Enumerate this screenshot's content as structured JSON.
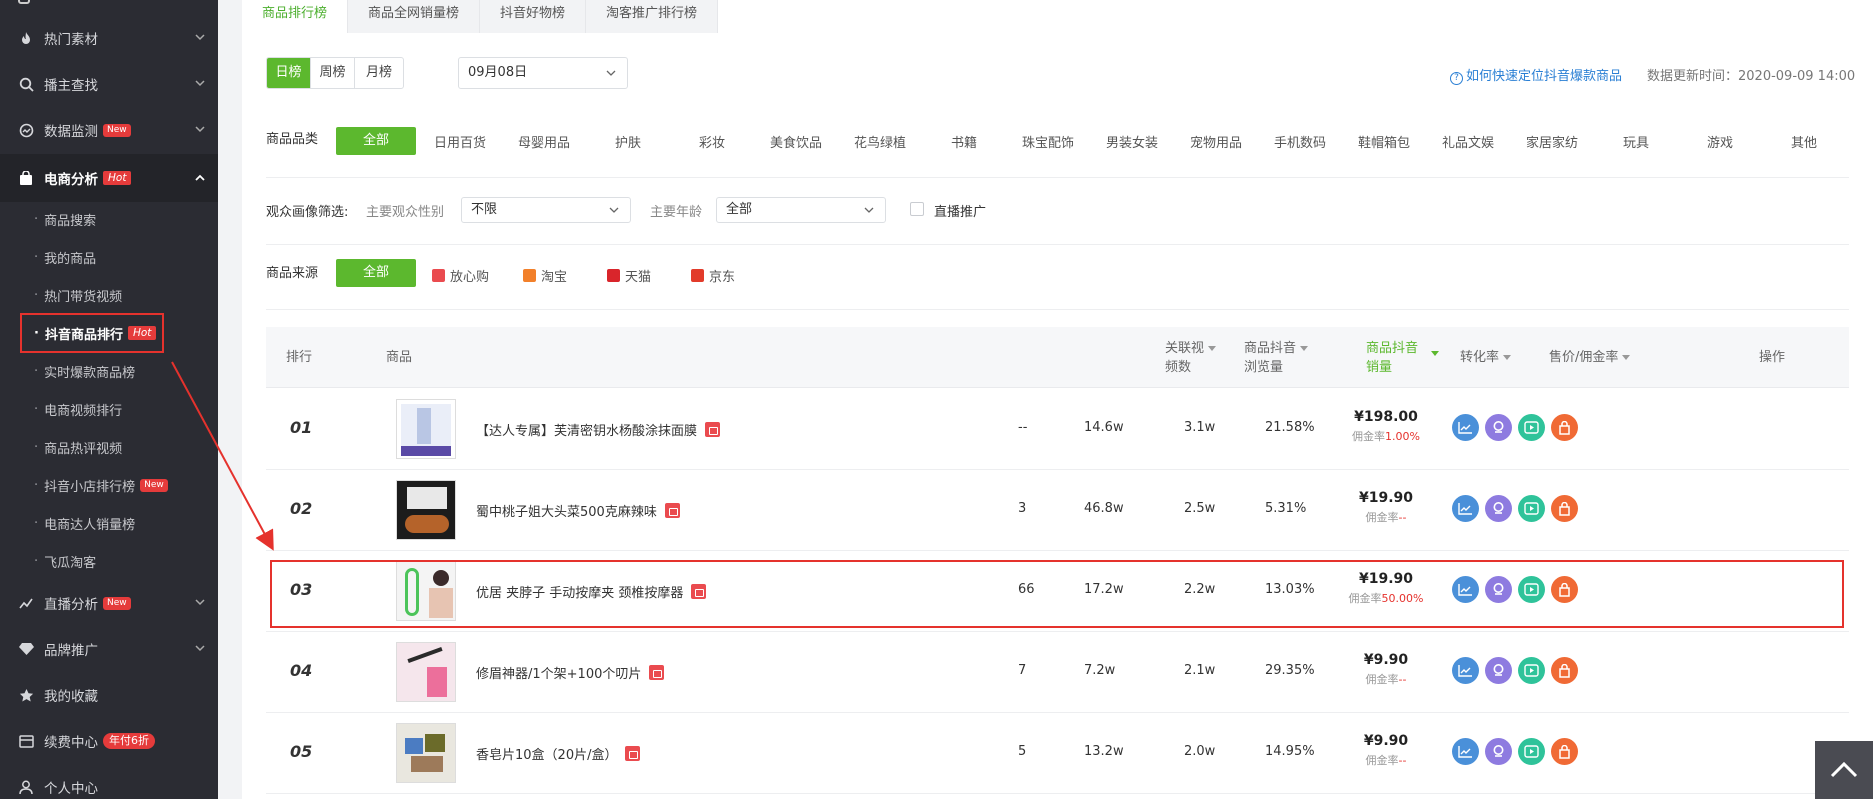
{
  "sidebar": {
    "items": [
      {
        "label": "热门素材",
        "icon": "fire-icon"
      },
      {
        "label": "播主查找",
        "icon": "search-icon"
      },
      {
        "label": "数据监测",
        "icon": "monitor-icon",
        "badge": "New"
      },
      {
        "label": "电商分析",
        "icon": "bag-icon",
        "badge": "Hot"
      },
      {
        "label": "直播分析",
        "icon": "live-icon",
        "badge": "New"
      },
      {
        "label": "品牌推广",
        "icon": "diamond-icon"
      },
      {
        "label": "我的收藏",
        "icon": "star-icon"
      },
      {
        "label": "续费中心",
        "icon": "card-icon",
        "badge": "年付6折"
      },
      {
        "label": "个人中心",
        "icon": "user-icon"
      }
    ],
    "sub_items": [
      {
        "label": "商品搜索"
      },
      {
        "label": "我的商品"
      },
      {
        "label": "热门带货视频"
      },
      {
        "label": "抖音商品排行",
        "badge": "Hot"
      },
      {
        "label": "实时爆款商品榜"
      },
      {
        "label": "电商视频排行"
      },
      {
        "label": "商品热评视频"
      },
      {
        "label": "抖音小店排行榜",
        "badge": "New"
      },
      {
        "label": "电商达人销量榜"
      },
      {
        "label": "飞瓜淘客"
      }
    ]
  },
  "tabs": [
    "商品排行榜",
    "商品全网销量榜",
    "抖音好物榜",
    "淘客推广排行榜"
  ],
  "period": {
    "options": [
      "日榜",
      "周榜",
      "月榜"
    ],
    "date": "09月08日"
  },
  "help_link": "如何快速定位抖音爆款商品",
  "update_time": "数据更新时间：2020-09-09 14:00",
  "category": {
    "label": "商品品类",
    "items": [
      "全部",
      "日用百货",
      "母婴用品",
      "护肤",
      "彩妆",
      "美食饮品",
      "花鸟绿植",
      "书籍",
      "珠宝配饰",
      "男装女装",
      "宠物用品",
      "手机数码",
      "鞋帽箱包",
      "礼品文娱",
      "家居家纺",
      "玩具",
      "游戏",
      "其他"
    ]
  },
  "audience": {
    "label": "观众画像筛选:",
    "gender_label": "主要观众性别",
    "gender_value": "不限",
    "age_label": "主要年龄",
    "age_value": "全部",
    "live_promo": "直播推广"
  },
  "source": {
    "label": "商品来源",
    "items": [
      {
        "name": "全部"
      },
      {
        "name": "放心购",
        "color": "#ea4b4f"
      },
      {
        "name": "淘宝",
        "color": "#f2802a"
      },
      {
        "name": "天猫",
        "color": "#d9252b"
      },
      {
        "name": "京东",
        "color": "#e23b2a"
      }
    ]
  },
  "table": {
    "headers": [
      "排行",
      "商品",
      "关联视频数",
      "商品抖音浏览量",
      "商品抖音销量",
      "转化率",
      "售价/佣金率",
      "操作"
    ],
    "header_lines": {
      "videos": [
        "关联视",
        "频数"
      ],
      "views": [
        "商品抖音",
        "浏览量"
      ],
      "sales": [
        "商品抖音",
        "销量"
      ]
    },
    "commission_label": "佣金率",
    "rows": [
      {
        "rank": "01",
        "name": "【达人专属】芙清密钥水杨酸涂抹面膜",
        "videos": "--",
        "views": "14.6w",
        "sales": "3.1w",
        "conversion": "21.58%",
        "price": "¥198.00",
        "commission": "1.00%"
      },
      {
        "rank": "02",
        "name": "蜀中桃子姐大头菜500克麻辣味",
        "videos": "3",
        "views": "46.8w",
        "sales": "2.5w",
        "conversion": "5.31%",
        "price": "¥19.90",
        "commission": "--"
      },
      {
        "rank": "03",
        "name": "优居 夹脖子 手动按摩夹 颈椎按摩器",
        "videos": "66",
        "views": "17.2w",
        "sales": "2.2w",
        "conversion": "13.03%",
        "price": "¥19.90",
        "commission": "50.00%"
      },
      {
        "rank": "04",
        "name": "修眉神器/1个架+100个叨片",
        "videos": "7",
        "views": "7.2w",
        "sales": "2.1w",
        "conversion": "29.35%",
        "price": "¥9.90",
        "commission": "--"
      },
      {
        "rank": "05",
        "name": "香皂片10盒（20片/盒）",
        "videos": "5",
        "views": "13.2w",
        "sales": "2.0w",
        "conversion": "14.95%",
        "price": "¥9.90",
        "commission": "--"
      }
    ],
    "action_icons": [
      "trend-icon",
      "user-badge-icon",
      "play-icon",
      "shop-icon"
    ],
    "action_colors": [
      "#4a90d9",
      "#8e7be0",
      "#2fc39a",
      "#f06a35"
    ]
  }
}
